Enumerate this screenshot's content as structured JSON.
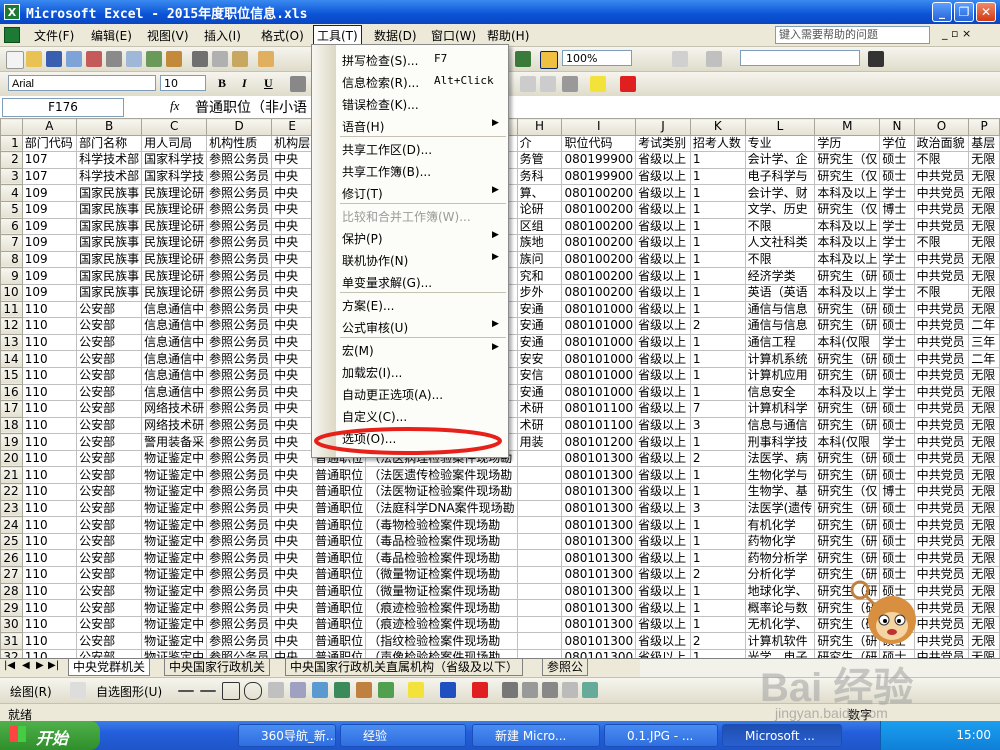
{
  "window": {
    "title": "Microsoft Excel - 2015年度职位信息.xls",
    "app_icon": "X",
    "controls": [
      "_",
      "❐",
      "✕"
    ]
  },
  "menu": {
    "items": [
      "文件(F)",
      "编辑(E)",
      "视图(V)",
      "插入(I)",
      "格式(O)",
      "工具(T)",
      "数据(D)",
      "窗口(W)",
      "帮助(H)"
    ],
    "help_placeholder": "键入需要帮助的问题",
    "doc_controls": "_ ▫ ×"
  },
  "toolbar": {
    "zoom": "100%"
  },
  "format": {
    "font": "Arial",
    "size": "10",
    "bold": "B",
    "italic": "I",
    "underline": "U"
  },
  "formula_bar": {
    "name_box": "F176",
    "fx": "fx",
    "formula": "普通职位（非小语"
  },
  "sheet": {
    "columns": [
      "A",
      "B",
      "C",
      "D",
      "E",
      "F",
      "G",
      "H",
      "I",
      "J",
      "K",
      "L",
      "M",
      "N",
      "O",
      "P"
    ],
    "rows": [
      [
        "1",
        "部门代码",
        "部门名称",
        "用人司局",
        "机构性质",
        "机构层",
        "",
        "",
        "介",
        "职位代码",
        "考试类别",
        "招考人数",
        "专业",
        "学历",
        "学位",
        "政治面貌",
        "基层"
      ],
      [
        "2",
        "107",
        "科学技术部",
        "国家科学技",
        "参照公务员",
        "中央",
        "",
        "",
        "务管",
        "080199900",
        "省级以上",
        "1",
        "会计学、企",
        "研究生（仅",
        "硕士",
        "不限",
        "无限"
      ],
      [
        "3",
        "107",
        "科学技术部",
        "国家科学技",
        "参照公务员",
        "中央",
        "",
        "",
        "务科",
        "080199900",
        "省级以上",
        "1",
        "电子科学与",
        "研究生（仅",
        "硕士",
        "中共党员",
        "无限"
      ],
      [
        "4",
        "109",
        "国家民族事",
        "民族理论研",
        "参照公务员",
        "中央",
        "",
        "",
        "算、",
        "080100200",
        "省级以上",
        "1",
        "会计学、财",
        "本科及以上",
        "学士",
        "中共党员",
        "无限"
      ],
      [
        "5",
        "109",
        "国家民族事",
        "民族理论研",
        "参照公务员",
        "中央",
        "",
        "",
        "论研",
        "080100200",
        "省级以上",
        "1",
        "文学、历史",
        "研究生（仅",
        "博士",
        "中共党员",
        "无限"
      ],
      [
        "6",
        "109",
        "国家民族事",
        "民族理论研",
        "参照公务员",
        "中央",
        "",
        "",
        "区组",
        "080100200",
        "省级以上",
        "1",
        "不限",
        "本科及以上",
        "学士",
        "中共党员",
        "无限"
      ],
      [
        "7",
        "109",
        "国家民族事",
        "民族理论研",
        "参照公务员",
        "中央",
        "",
        "",
        "族地",
        "080100200",
        "省级以上",
        "1",
        "人文社科类",
        "本科及以上",
        "学士",
        "不限",
        "无限"
      ],
      [
        "8",
        "109",
        "国家民族事",
        "民族理论研",
        "参照公务员",
        "中央",
        "",
        "",
        "族问",
        "080100200",
        "省级以上",
        "1",
        "不限",
        "本科及以上",
        "学士",
        "中共党员",
        "无限"
      ],
      [
        "9",
        "109",
        "国家民族事",
        "民族理论研",
        "参照公务员",
        "中央",
        "",
        "",
        "究和",
        "080100200",
        "省级以上",
        "1",
        "经济学类",
        "研究生（研",
        "硕士",
        "中共党员",
        "无限"
      ],
      [
        "10",
        "109",
        "国家民族事",
        "民族理论研",
        "参照公务员",
        "中央",
        "",
        "",
        "步外",
        "080100200",
        "省级以上",
        "1",
        "英语（英语",
        "本科及以上",
        "学士",
        "不限",
        "无限"
      ],
      [
        "11",
        "110",
        "公安部",
        "信息通信中",
        "参照公务员",
        "中央",
        "",
        "",
        "安通",
        "080101000",
        "省级以上",
        "1",
        "通信与信息",
        "研究生（研",
        "硕士",
        "中共党员",
        "无限"
      ],
      [
        "12",
        "110",
        "公安部",
        "信息通信中",
        "参照公务员",
        "中央",
        "",
        "",
        "安通",
        "080101000",
        "省级以上",
        "2",
        "通信与信息",
        "研究生（研",
        "硕士",
        "中共党员",
        "二年"
      ],
      [
        "13",
        "110",
        "公安部",
        "信息通信中",
        "参照公务员",
        "中央",
        "",
        "",
        "安通",
        "080101000",
        "省级以上",
        "1",
        "通信工程",
        "本科(仅限",
        "学士",
        "中共党员",
        "三年"
      ],
      [
        "14",
        "110",
        "公安部",
        "信息通信中",
        "参照公务员",
        "中央",
        "",
        "",
        "安安",
        "080101000",
        "省级以上",
        "1",
        "计算机系统",
        "研究生（研",
        "硕士",
        "中共党员",
        "二年"
      ],
      [
        "15",
        "110",
        "公安部",
        "信息通信中",
        "参照公务员",
        "中央",
        "",
        "",
        "安信",
        "080101000",
        "省级以上",
        "1",
        "计算机应用",
        "研究生（研",
        "硕士",
        "中共党员",
        "无限"
      ],
      [
        "16",
        "110",
        "公安部",
        "信息通信中",
        "参照公务员",
        "中央",
        "",
        "",
        "安通",
        "080101000",
        "省级以上",
        "1",
        "信息安全",
        "本科及以上",
        "学士",
        "中共党员",
        "无限"
      ],
      [
        "17",
        "110",
        "公安部",
        "网络技术研",
        "参照公务员",
        "中央",
        "",
        "",
        "术研",
        "080101100",
        "省级以上",
        "7",
        "计算机科学",
        "研究生（研",
        "硕士",
        "中共党员",
        "无限"
      ],
      [
        "18",
        "110",
        "公安部",
        "网络技术研",
        "参照公务员",
        "中央",
        "",
        "",
        "术研",
        "080101100",
        "省级以上",
        "3",
        "信息与通信",
        "研究生（研",
        "硕士",
        "中共党员",
        "无限"
      ],
      [
        "19",
        "110",
        "公安部",
        "警用装备采",
        "参照公务员",
        "中央",
        "",
        "",
        "用装",
        "080101200",
        "省级以上",
        "1",
        "刑事科学技",
        "本科(仅限",
        "学士",
        "中共党员",
        "无限"
      ],
      [
        "20",
        "110",
        "公安部",
        "物证鉴定中",
        "参照公务员",
        "中央",
        "普通职位",
        "（法医病理检验案件现场勘",
        "",
        "080101300",
        "省级以上",
        "2",
        "法医学、病",
        "研究生（研",
        "硕士",
        "中共党员",
        "无限"
      ],
      [
        "21",
        "110",
        "公安部",
        "物证鉴定中",
        "参照公务员",
        "中央",
        "普通职位",
        "（法医遗传检验案件现场勘",
        "",
        "080101300",
        "省级以上",
        "1",
        "生物化学与",
        "研究生（研",
        "硕士",
        "中共党员",
        "无限"
      ],
      [
        "22",
        "110",
        "公安部",
        "物证鉴定中",
        "参照公务员",
        "中央",
        "普通职位",
        "（法医物证检验案件现场勘",
        "",
        "080101300",
        "省级以上",
        "1",
        "生物学、基",
        "研究生（仅",
        "博士",
        "中共党员",
        "无限"
      ],
      [
        "23",
        "110",
        "公安部",
        "物证鉴定中",
        "参照公务员",
        "中央",
        "普通职位",
        "（法庭科学DNA案件现场勘",
        "",
        "080101300",
        "省级以上",
        "3",
        "法医学(遗传",
        "研究生（研",
        "硕士",
        "中共党员",
        "无限"
      ],
      [
        "24",
        "110",
        "公安部",
        "物证鉴定中",
        "参照公务员",
        "中央",
        "普通职位",
        "（毒物检验检案件现场勘",
        "",
        "080101300",
        "省级以上",
        "1",
        "有机化学",
        "研究生（研",
        "硕士",
        "中共党员",
        "无限"
      ],
      [
        "25",
        "110",
        "公安部",
        "物证鉴定中",
        "参照公务员",
        "中央",
        "普通职位",
        "（毒品检验检案件现场勘",
        "",
        "080101300",
        "省级以上",
        "1",
        "药物化学",
        "研究生（研",
        "硕士",
        "中共党员",
        "无限"
      ],
      [
        "26",
        "110",
        "公安部",
        "物证鉴定中",
        "参照公务员",
        "中央",
        "普通职位",
        "（毒品检验检案件现场勘",
        "",
        "080101300",
        "省级以上",
        "1",
        "药物分析学",
        "研究生（研",
        "硕士",
        "中共党员",
        "无限"
      ],
      [
        "27",
        "110",
        "公安部",
        "物证鉴定中",
        "参照公务员",
        "中央",
        "普通职位",
        "（微量物证检案件现场勘",
        "",
        "080101300",
        "省级以上",
        "2",
        "分析化学",
        "研究生（研",
        "硕士",
        "中共党员",
        "无限"
      ],
      [
        "28",
        "110",
        "公安部",
        "物证鉴定中",
        "参照公务员",
        "中央",
        "普通职位",
        "（微量物证检案件现场勘",
        "",
        "080101300",
        "省级以上",
        "1",
        "地球化学、",
        "研究生（研",
        "硕士",
        "中共党员",
        "无限"
      ],
      [
        "29",
        "110",
        "公安部",
        "物证鉴定中",
        "参照公务员",
        "中央",
        "普通职位",
        "（痕迹检验检案件现场勘",
        "",
        "080101300",
        "省级以上",
        "1",
        "概率论与数",
        "研究生（研",
        "硕士",
        "中共党员",
        "无限"
      ],
      [
        "30",
        "110",
        "公安部",
        "物证鉴定中",
        "参照公务员",
        "中央",
        "普通职位",
        "（痕迹检验检案件现场勘",
        "",
        "080101300",
        "省级以上",
        "1",
        "无机化学、",
        "研究生（研",
        "硕士",
        "中共党员",
        "无限"
      ],
      [
        "31",
        "110",
        "公安部",
        "物证鉴定中",
        "参照公务员",
        "中央",
        "普通职位",
        "（指纹检验检案件现场勘",
        "",
        "080101300",
        "省级以上",
        "2",
        "计算机软件",
        "研究生（研",
        "硕士",
        "中共党员",
        "无限"
      ],
      [
        "32",
        "110",
        "公安部",
        "物证鉴定中",
        "参照公务员",
        "中央",
        "普通职位",
        "（声像检验检案件现场勘",
        "",
        "080101300",
        "省级以上",
        "1",
        "光学、电子",
        "研究生（研",
        "硕士",
        "中共党员",
        "无限"
      ]
    ]
  },
  "tools_menu": {
    "items": [
      {
        "label": "拼写检查(S)...",
        "shortcut": "F7",
        "arrow": ""
      },
      {
        "label": "信息检索(R)...",
        "shortcut": "Alt+Click",
        "arrow": ""
      },
      {
        "label": "错误检查(K)...",
        "shortcut": "",
        "arrow": ""
      },
      {
        "label": "语音(H)",
        "shortcut": "",
        "arrow": "▶"
      },
      {
        "label": "共享工作区(D)...",
        "shortcut": "",
        "arrow": ""
      },
      {
        "label": "共享工作簿(B)...",
        "shortcut": "",
        "arrow": ""
      },
      {
        "label": "修订(T)",
        "shortcut": "",
        "arrow": "▶"
      },
      {
        "label": "比较和合并工作簿(W)...",
        "shortcut": "",
        "arrow": ""
      },
      {
        "label": "保护(P)",
        "shortcut": "",
        "arrow": "▶"
      },
      {
        "label": "联机协作(N)",
        "shortcut": "",
        "arrow": "▶"
      },
      {
        "label": "单变量求解(G)...",
        "shortcut": "",
        "arrow": ""
      },
      {
        "label": "方案(E)...",
        "shortcut": "",
        "arrow": ""
      },
      {
        "label": "公式审核(U)",
        "shortcut": "",
        "arrow": "▶"
      },
      {
        "label": "宏(M)",
        "shortcut": "",
        "arrow": "▶"
      },
      {
        "label": "加载宏(I)...",
        "shortcut": "",
        "arrow": ""
      },
      {
        "label": "自动更正选项(A)...",
        "shortcut": "",
        "arrow": ""
      },
      {
        "label": "自定义(C)...",
        "shortcut": "",
        "arrow": ""
      },
      {
        "label": "选项(O)...",
        "shortcut": "",
        "arrow": ""
      }
    ],
    "highlight_color": "#e8201a"
  },
  "sheet_tabs": {
    "nav": [
      "|◀",
      "◀",
      "▶",
      "▶|"
    ],
    "tabs": [
      "中央党群机关",
      "中央国家行政机关",
      "中央国家行政机关直属机构（省级及以下）",
      "参照公"
    ]
  },
  "draw_toolbar": {
    "draw_label": "绘图(R)",
    "autoshape_label": "自选图形(U)"
  },
  "status": {
    "ready": "就绪",
    "num": "数字"
  },
  "taskbar": {
    "start": "开始",
    "buttons": [
      "360导航_新...",
      "经验",
      "新建 Micro...",
      "0.1.JPG - ...",
      "Microsoft ..."
    ],
    "clock": "15:00"
  },
  "watermark": {
    "brand": "Bai 经验",
    "url": "jingyan.baidu.com"
  }
}
